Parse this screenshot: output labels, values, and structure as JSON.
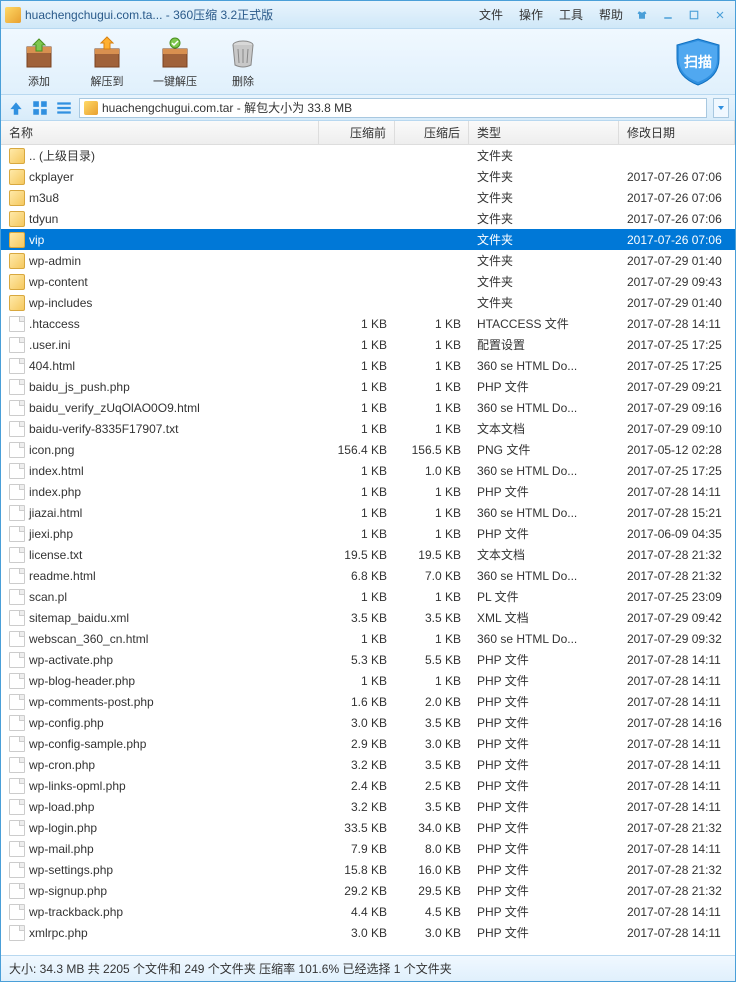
{
  "window": {
    "title": "huachengchugui.com.ta... - 360压缩 3.2正式版"
  },
  "menu": {
    "file": "文件",
    "operate": "操作",
    "tools": "工具",
    "help": "帮助"
  },
  "toolbar": {
    "add": "添加",
    "extract_to": "解压到",
    "one_click": "一键解压",
    "delete": "删除",
    "scan": "扫描"
  },
  "navbar": {
    "path": "huachengchugui.com.tar - 解包大小为 33.8 MB"
  },
  "headers": {
    "name": "名称",
    "before": "压缩前",
    "after": "压缩后",
    "type": "类型",
    "date": "修改日期"
  },
  "files": [
    {
      "name": ".. (上级目录)",
      "before": "",
      "after": "",
      "type": "文件夹",
      "date": "",
      "icon": "folder"
    },
    {
      "name": "ckplayer",
      "before": "",
      "after": "",
      "type": "文件夹",
      "date": "2017-07-26 07:06",
      "icon": "folder"
    },
    {
      "name": "m3u8",
      "before": "",
      "after": "",
      "type": "文件夹",
      "date": "2017-07-26 07:06",
      "icon": "folder"
    },
    {
      "name": "tdyun",
      "before": "",
      "after": "",
      "type": "文件夹",
      "date": "2017-07-26 07:06",
      "icon": "folder"
    },
    {
      "name": "vip",
      "before": "",
      "after": "",
      "type": "文件夹",
      "date": "2017-07-26 07:06",
      "icon": "folder",
      "selected": true
    },
    {
      "name": "wp-admin",
      "before": "",
      "after": "",
      "type": "文件夹",
      "date": "2017-07-29 01:40",
      "icon": "folder"
    },
    {
      "name": "wp-content",
      "before": "",
      "after": "",
      "type": "文件夹",
      "date": "2017-07-29 09:43",
      "icon": "folder"
    },
    {
      "name": "wp-includes",
      "before": "",
      "after": "",
      "type": "文件夹",
      "date": "2017-07-29 01:40",
      "icon": "folder"
    },
    {
      "name": ".htaccess",
      "before": "1 KB",
      "after": "1 KB",
      "type": "HTACCESS 文件",
      "date": "2017-07-28 14:11",
      "icon": "file"
    },
    {
      "name": ".user.ini",
      "before": "1 KB",
      "after": "1 KB",
      "type": "配置设置",
      "date": "2017-07-25 17:25",
      "icon": "file"
    },
    {
      "name": "404.html",
      "before": "1 KB",
      "after": "1 KB",
      "type": "360 se HTML Do...",
      "date": "2017-07-25 17:25",
      "icon": "file"
    },
    {
      "name": "baidu_js_push.php",
      "before": "1 KB",
      "after": "1 KB",
      "type": "PHP 文件",
      "date": "2017-07-29 09:21",
      "icon": "file"
    },
    {
      "name": "baidu_verify_zUqOlAO0O9.html",
      "before": "1 KB",
      "after": "1 KB",
      "type": "360 se HTML Do...",
      "date": "2017-07-29 09:16",
      "icon": "file"
    },
    {
      "name": "baidu-verify-8335F17907.txt",
      "before": "1 KB",
      "after": "1 KB",
      "type": "文本文档",
      "date": "2017-07-29 09:10",
      "icon": "file"
    },
    {
      "name": "icon.png",
      "before": "156.4 KB",
      "after": "156.5 KB",
      "type": "PNG 文件",
      "date": "2017-05-12 02:28",
      "icon": "file"
    },
    {
      "name": "index.html",
      "before": "1 KB",
      "after": "1.0 KB",
      "type": "360 se HTML Do...",
      "date": "2017-07-25 17:25",
      "icon": "file"
    },
    {
      "name": "index.php",
      "before": "1 KB",
      "after": "1 KB",
      "type": "PHP 文件",
      "date": "2017-07-28 14:11",
      "icon": "file"
    },
    {
      "name": "jiazai.html",
      "before": "1 KB",
      "after": "1 KB",
      "type": "360 se HTML Do...",
      "date": "2017-07-28 15:21",
      "icon": "file"
    },
    {
      "name": "jiexi.php",
      "before": "1 KB",
      "after": "1 KB",
      "type": "PHP 文件",
      "date": "2017-06-09 04:35",
      "icon": "file"
    },
    {
      "name": "license.txt",
      "before": "19.5 KB",
      "after": "19.5 KB",
      "type": "文本文档",
      "date": "2017-07-28 21:32",
      "icon": "file"
    },
    {
      "name": "readme.html",
      "before": "6.8 KB",
      "after": "7.0 KB",
      "type": "360 se HTML Do...",
      "date": "2017-07-28 21:32",
      "icon": "file"
    },
    {
      "name": "scan.pl",
      "before": "1 KB",
      "after": "1 KB",
      "type": "PL 文件",
      "date": "2017-07-25 23:09",
      "icon": "file"
    },
    {
      "name": "sitemap_baidu.xml",
      "before": "3.5 KB",
      "after": "3.5 KB",
      "type": "XML 文档",
      "date": "2017-07-29 09:42",
      "icon": "file"
    },
    {
      "name": "webscan_360_cn.html",
      "before": "1 KB",
      "after": "1 KB",
      "type": "360 se HTML Do...",
      "date": "2017-07-29 09:32",
      "icon": "file"
    },
    {
      "name": "wp-activate.php",
      "before": "5.3 KB",
      "after": "5.5 KB",
      "type": "PHP 文件",
      "date": "2017-07-28 14:11",
      "icon": "file"
    },
    {
      "name": "wp-blog-header.php",
      "before": "1 KB",
      "after": "1 KB",
      "type": "PHP 文件",
      "date": "2017-07-28 14:11",
      "icon": "file"
    },
    {
      "name": "wp-comments-post.php",
      "before": "1.6 KB",
      "after": "2.0 KB",
      "type": "PHP 文件",
      "date": "2017-07-28 14:11",
      "icon": "file"
    },
    {
      "name": "wp-config.php",
      "before": "3.0 KB",
      "after": "3.5 KB",
      "type": "PHP 文件",
      "date": "2017-07-28 14:16",
      "icon": "file"
    },
    {
      "name": "wp-config-sample.php",
      "before": "2.9 KB",
      "after": "3.0 KB",
      "type": "PHP 文件",
      "date": "2017-07-28 14:11",
      "icon": "file"
    },
    {
      "name": "wp-cron.php",
      "before": "3.2 KB",
      "after": "3.5 KB",
      "type": "PHP 文件",
      "date": "2017-07-28 14:11",
      "icon": "file"
    },
    {
      "name": "wp-links-opml.php",
      "before": "2.4 KB",
      "after": "2.5 KB",
      "type": "PHP 文件",
      "date": "2017-07-28 14:11",
      "icon": "file"
    },
    {
      "name": "wp-load.php",
      "before": "3.2 KB",
      "after": "3.5 KB",
      "type": "PHP 文件",
      "date": "2017-07-28 14:11",
      "icon": "file"
    },
    {
      "name": "wp-login.php",
      "before": "33.5 KB",
      "after": "34.0 KB",
      "type": "PHP 文件",
      "date": "2017-07-28 21:32",
      "icon": "file"
    },
    {
      "name": "wp-mail.php",
      "before": "7.9 KB",
      "after": "8.0 KB",
      "type": "PHP 文件",
      "date": "2017-07-28 14:11",
      "icon": "file"
    },
    {
      "name": "wp-settings.php",
      "before": "15.8 KB",
      "after": "16.0 KB",
      "type": "PHP 文件",
      "date": "2017-07-28 21:32",
      "icon": "file"
    },
    {
      "name": "wp-signup.php",
      "before": "29.2 KB",
      "after": "29.5 KB",
      "type": "PHP 文件",
      "date": "2017-07-28 21:32",
      "icon": "file"
    },
    {
      "name": "wp-trackback.php",
      "before": "4.4 KB",
      "after": "4.5 KB",
      "type": "PHP 文件",
      "date": "2017-07-28 14:11",
      "icon": "file"
    },
    {
      "name": "xmlrpc.php",
      "before": "3.0 KB",
      "after": "3.0 KB",
      "type": "PHP 文件",
      "date": "2017-07-28 14:11",
      "icon": "file"
    }
  ],
  "statusbar": {
    "text": "大小: 34.3 MB 共 2205 个文件和 249 个文件夹 压缩率 101.6% 已经选择 1 个文件夹"
  }
}
